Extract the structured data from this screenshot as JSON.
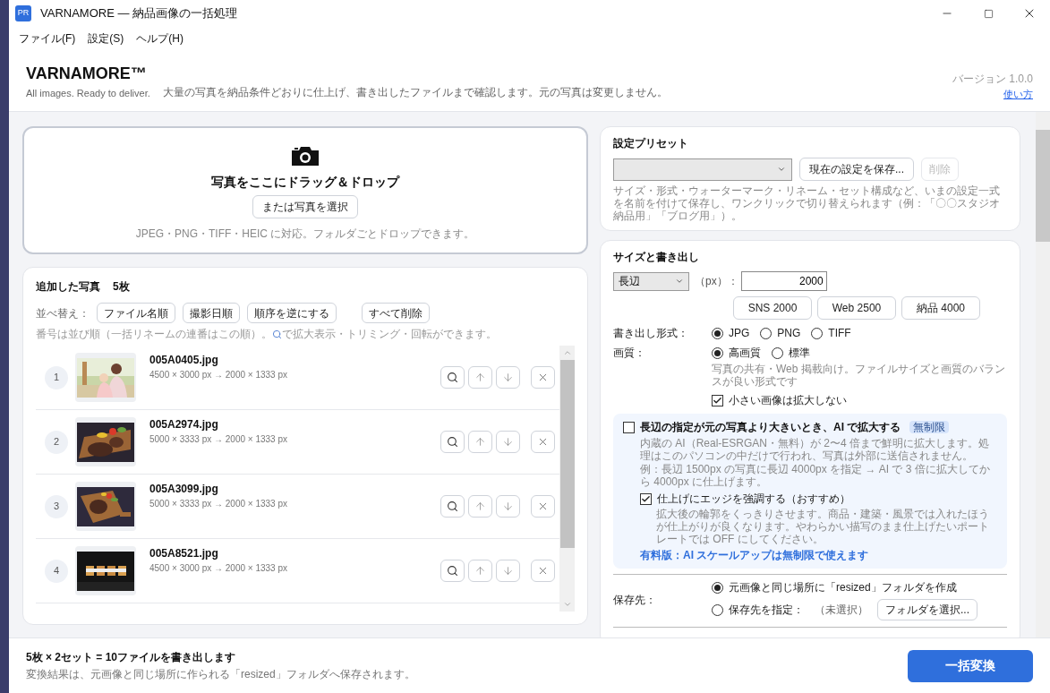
{
  "window": {
    "title": "VARNAMORE — 納品画像の一括処理",
    "app_icon": "PR"
  },
  "menu": [
    "ファイル(F)",
    "設定(S)",
    "ヘルプ(H)"
  ],
  "header": {
    "brand": "VARNAMORE™",
    "tagline": "All images. Ready to deliver.",
    "description": "大量の写真を納品条件どおりに仕上げ、書き出したファイルまで確認します。元の写真は変更しません。",
    "version": "バージョン 1.0.0",
    "help_link": "使い方"
  },
  "dropzone": {
    "title": "写真をここにドラッグ＆ドロップ",
    "button": "または写真を選択",
    "note": "JPEG・PNG・TIFF・HEIC に対応。フォルダごとドロップできます。"
  },
  "photos": {
    "title": "追加した写真",
    "count": "5枚",
    "sort_label": "並べ替え：",
    "sort_buttons": [
      "ファイル名順",
      "撮影日順",
      "順序を逆にする"
    ],
    "clear_button": "すべて削除",
    "hint_before": "番号は並び順（一括リネームの連番はこの順）。",
    "hint_after": "で拡大表示・トリミング・回転ができます。",
    "items": [
      {
        "number": "1",
        "filename": "005A0405.jpg",
        "size": "4500 × 3000 px → 2000 × 1333 px",
        "kind": "picture"
      },
      {
        "number": "2",
        "filename": "005A2974.jpg",
        "size": "5000 × 3333 px → 2000 × 1333 px",
        "kind": "picture"
      },
      {
        "number": "3",
        "filename": "005A3099.jpg",
        "size": "5000 × 3333 px → 2000 × 1333 px",
        "kind": "picture"
      },
      {
        "number": "4",
        "filename": "005A8521.jpg",
        "size": "4500 × 3000 px → 2000 × 1333 px",
        "kind": "picture"
      }
    ]
  },
  "preset": {
    "title": "設定プリセット",
    "save_button": "現在の設定を保存...",
    "delete_button": {
      "label": "削除",
      "disabled": true
    },
    "note": "サイズ・形式・ウォーターマーク・リネーム・セット構成など、いまの設定一式を名前を付けて保存し、ワンクリックで切り替えられます（例：「〇〇スタジオ納品用」「ブログ用」）。"
  },
  "size": {
    "title": "サイズと書き出し",
    "side_select": "長辺",
    "unit": "（px）：",
    "value": "2000",
    "quick_buttons": [
      "SNS 2000",
      "Web 2500",
      "納品 4000"
    ],
    "format_label": "書き出し形式：",
    "formats": [
      {
        "label": "JPG",
        "selected": true
      },
      {
        "label": "PNG",
        "selected": false
      },
      {
        "label": "TIFF",
        "selected": false
      }
    ],
    "quality_label": "画質：",
    "qualities": [
      {
        "label": "高画質",
        "selected": true
      },
      {
        "label": "標準",
        "selected": false
      }
    ],
    "quality_note": "写真の共有・Web 掲載向け。ファイルサイズと画質のバランスが良い形式です",
    "no_upscale": {
      "label": "小さい画像は拡大しない",
      "checked": true
    },
    "ai": {
      "label": "長辺の指定が元の写真より大きいとき、AI で拡大する",
      "checked": false,
      "badge": "無制限",
      "desc": "内蔵の AI（Real-ESRGAN・無料）が 2〜4 倍まで鮮明に拡大します。処理はこのパソコンの中だけで行われ、写真は外部に送信されません。",
      "example": "例：長辺 1500px の写真に長辺 4000px を指定 → AI で 3 倍に拡大してから 4000px に仕上げます。",
      "edge": {
        "label": "仕上げにエッジを強調する（おすすめ）",
        "checked": true
      },
      "edge_note": "拡大後の輪郭をくっきりさせます。商品・建築・風景では入れたほうが仕上がりが良くなります。やわらかい描写のまま仕上げたいポートレートでは OFF にしてください。",
      "upsell": "有料版：AI スケールアップは無制限で使えます"
    },
    "dest_label": "保存先：",
    "dest_options": [
      {
        "label": "元画像と同じ場所に「resized」フォルダを作成",
        "selected": true
      },
      {
        "label": "保存先を指定：",
        "selected": false,
        "status": "（未選択）",
        "button": "フォルダを選択..."
      }
    ]
  },
  "footer": {
    "summary": "5枚 × 2セット = 10ファイルを書き出します",
    "note": "変換結果は、元画像と同じ場所に作られる「resized」フォルダへ保存されます。",
    "convert_button": "一括変換"
  }
}
